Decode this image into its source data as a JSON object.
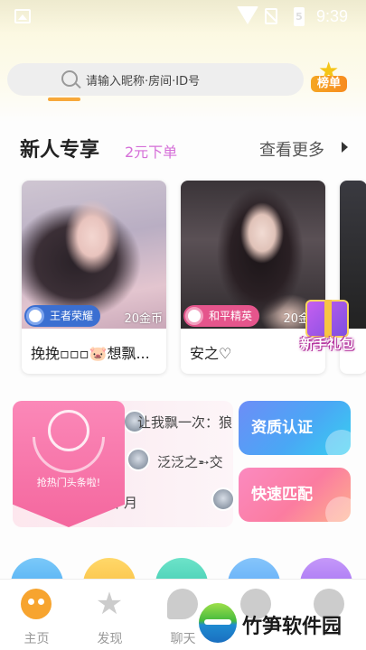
{
  "status_bar": {
    "time": "9:39",
    "battery_text": "5"
  },
  "search": {
    "placeholder": "请输入昵称·房间·ID号"
  },
  "rank_button": {
    "label": "榜单"
  },
  "new_section": {
    "title": "新人专享",
    "subtitle": "2元下单",
    "more_label": "查看更多"
  },
  "cards": [
    {
      "name": "挽挽▫▫▫🐷想飘...",
      "game": "王者荣耀",
      "price": "20金币"
    },
    {
      "name": "安之♡",
      "game": "和平精英",
      "price": "20金币"
    }
  ],
  "gift": {
    "label": "新手礼包"
  },
  "hot": {
    "badge_label": "抢热门头条啦!",
    "bullets": [
      {
        "text": "让我飘一次：狼"
      },
      {
        "text": "泛泛之➵交"
      },
      {
        "text": "十月"
      }
    ]
  },
  "actions": {
    "cert_label": "资质认证",
    "match_label": "快速匹配"
  },
  "tabs": [
    {
      "label": "主页"
    },
    {
      "label": "发现"
    },
    {
      "label": "聊天"
    },
    {
      "label": ""
    },
    {
      "label": ""
    }
  ],
  "watermark": {
    "text": "竹笋软件园"
  },
  "colors": {
    "accent": "#f6a02b",
    "subtitle_pink": "#d56fd8",
    "cert_blue": "#4aa7f5",
    "match_pink": "#fb7ca0"
  }
}
